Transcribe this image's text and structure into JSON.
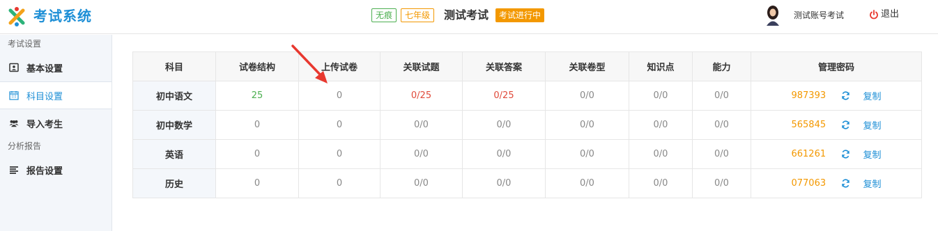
{
  "app": {
    "brand": "考试系统"
  },
  "header": {
    "tags": [
      "无痕",
      "七年级"
    ],
    "exam_title": "测试考试",
    "status": "考试进行中",
    "account": "测试账号考试",
    "logout": "退出"
  },
  "sidebar": {
    "section1": "考试设置",
    "items": [
      {
        "label": "基本设置",
        "icon": "id-card-icon"
      },
      {
        "label": "科目设置",
        "icon": "calendar-icon"
      },
      {
        "label": "导入考生",
        "icon": "users-icon"
      }
    ],
    "section2": "分析报告",
    "items2": [
      {
        "label": "报告设置",
        "icon": "list-icon"
      }
    ]
  },
  "table": {
    "headers": [
      "科目",
      "试卷结构",
      "上传试卷",
      "关联试题",
      "关联答案",
      "关联卷型",
      "知识点",
      "能力",
      "管理密码"
    ],
    "copy_label": "复制",
    "rows": [
      {
        "subject": "初中语文",
        "structure": "25",
        "upload": "0",
        "questions": "0/25",
        "answers": "0/25",
        "papers": "0/0",
        "knowledge": "0/0",
        "ability": "0/0",
        "password": "987393"
      },
      {
        "subject": "初中数学",
        "structure": "0",
        "upload": "0",
        "questions": "0/0",
        "answers": "0/0",
        "papers": "0/0",
        "knowledge": "0/0",
        "ability": "0/0",
        "password": "565845"
      },
      {
        "subject": "英语",
        "structure": "0",
        "upload": "0",
        "questions": "0/0",
        "answers": "0/0",
        "papers": "0/0",
        "knowledge": "0/0",
        "ability": "0/0",
        "password": "661261"
      },
      {
        "subject": "历史",
        "structure": "0",
        "upload": "0",
        "questions": "0/0",
        "answers": "0/0",
        "papers": "0/0",
        "knowledge": "0/0",
        "ability": "0/0",
        "password": "077063"
      }
    ]
  },
  "colors": {
    "brand": "#1e8fd6",
    "orange": "#f39800",
    "green": "#4caf50",
    "red": "#e04a3a",
    "arrow": "#e8382f"
  }
}
